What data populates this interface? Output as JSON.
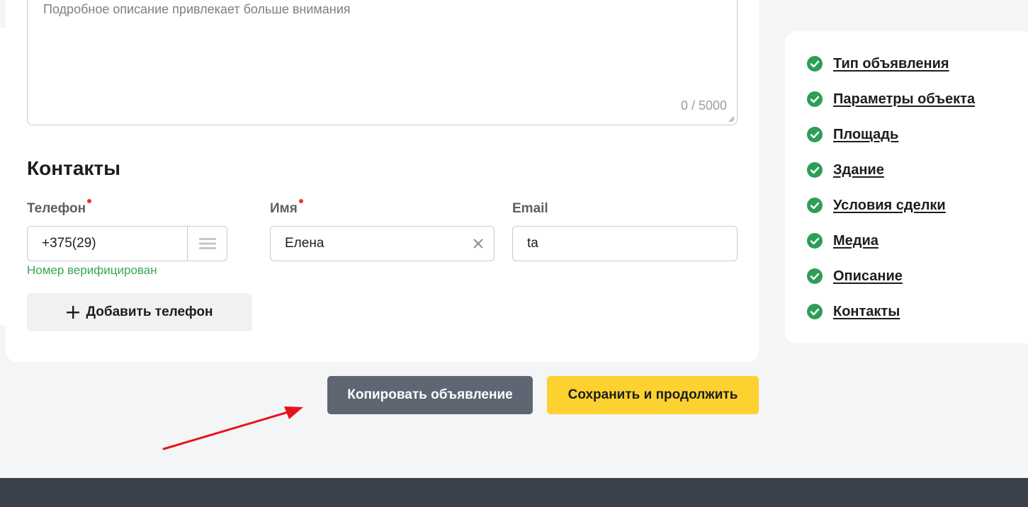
{
  "description": {
    "placeholder": "Подробное описание привлекает больше внимания",
    "counter": "0 / 5000"
  },
  "contacts": {
    "title": "Контакты",
    "phone_label": "Телефон",
    "phone_value": "+375(29)",
    "name_label": "Имя",
    "name_value": "Елена",
    "email_label": "Email",
    "email_value": "ta",
    "verified_text": "Номер верифицирован",
    "add_phone_label": "Добавить телефон"
  },
  "actions": {
    "copy_label": "Копировать объявление",
    "save_label": "Сохранить и продолжить"
  },
  "nav": {
    "items": [
      {
        "label": "Тип объявления"
      },
      {
        "label": "Параметры объекта"
      },
      {
        "label": "Площадь"
      },
      {
        "label": "Здание"
      },
      {
        "label": "Условия сделки"
      },
      {
        "label": "Медиа"
      },
      {
        "label": "Описание"
      },
      {
        "label": "Контакты"
      }
    ]
  },
  "colors": {
    "accent_yellow": "#fdd130",
    "copy_button": "#5e6673",
    "success_green": "#34a853",
    "check_green": "#2e9e57",
    "required_red": "#e53935",
    "footer": "#3a414b",
    "annotation_arrow": "#e8141b"
  },
  "icons": {
    "nav_check": "check-circle-icon",
    "phone_menu": "hamburger-menu-icon",
    "clear": "close-icon",
    "add": "plus-icon"
  }
}
